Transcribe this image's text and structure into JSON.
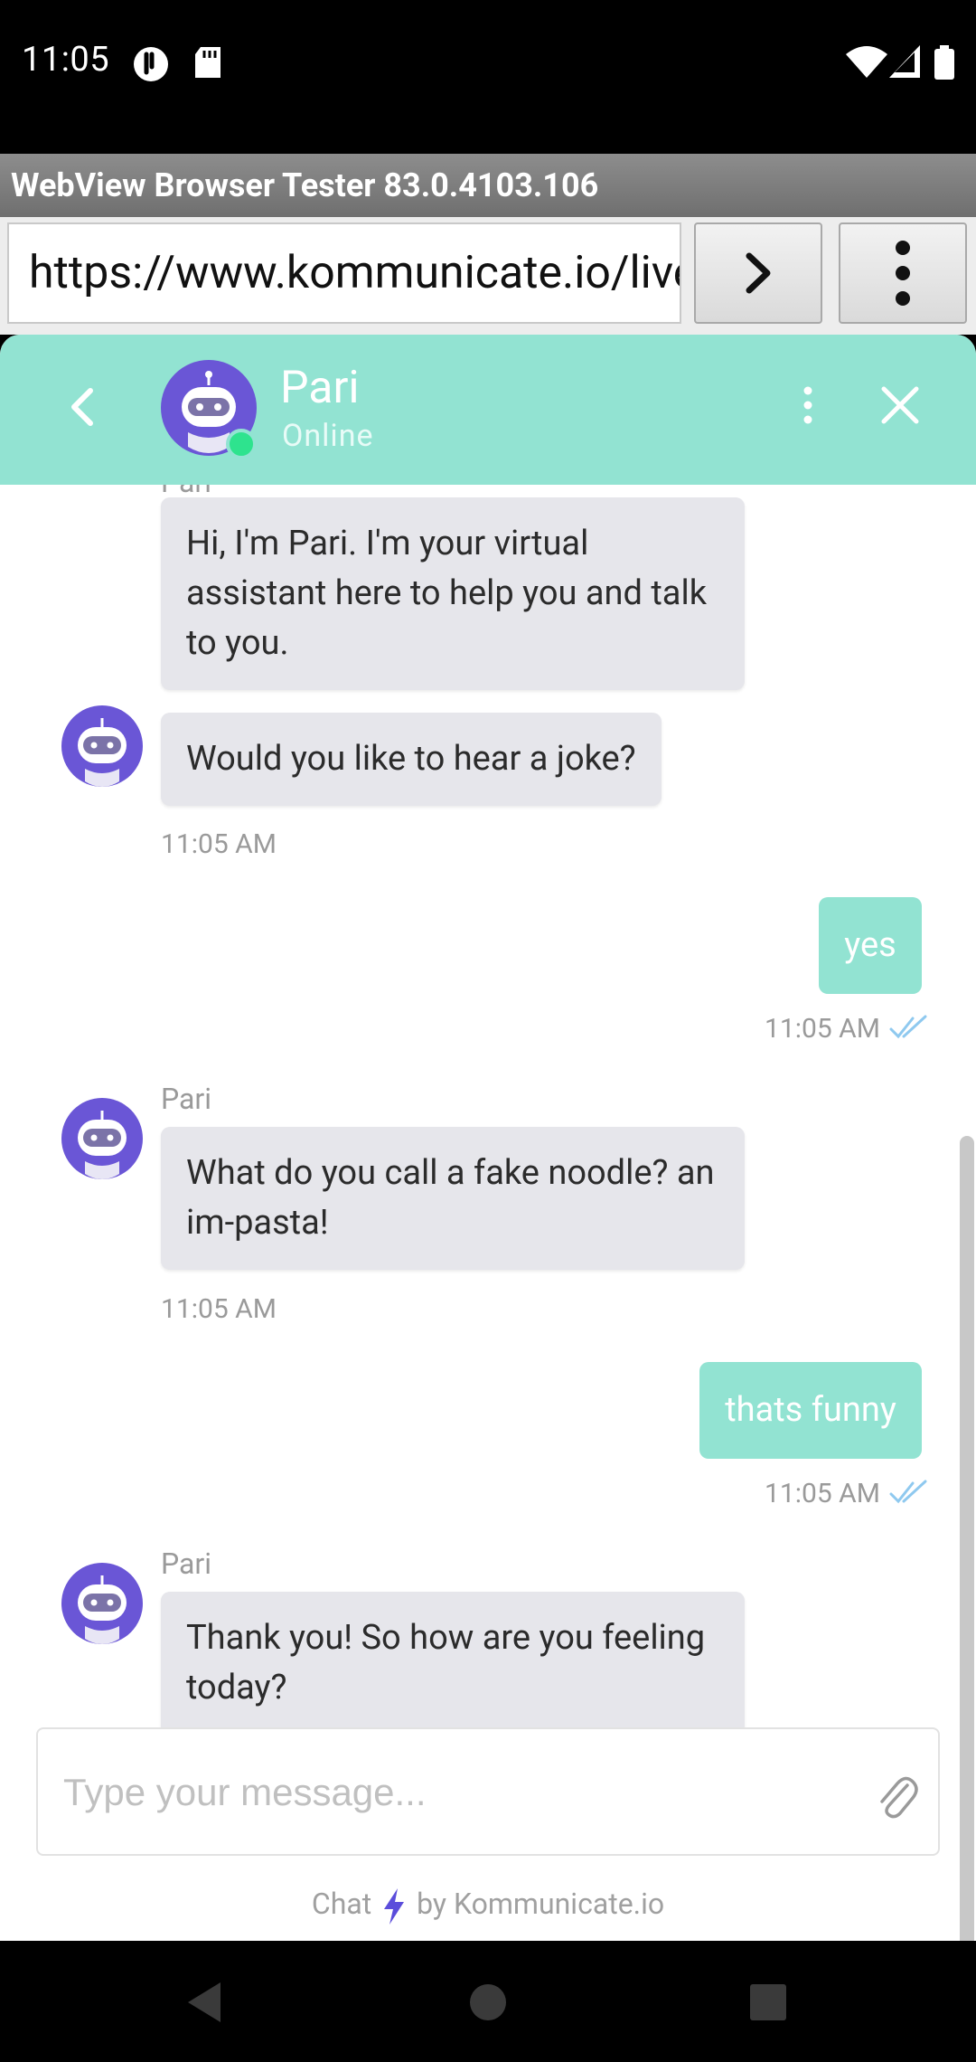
{
  "status_bar": {
    "time": "11:05",
    "icons": [
      "cursor-app-icon",
      "sd-card-icon",
      "wifi-icon",
      "signal-icon",
      "battery-icon"
    ]
  },
  "browser": {
    "title": "WebView Browser Tester 83.0.4103.106",
    "url": "https://www.kommunicate.io/livechat-demo",
    "go_icon": "chevron-right-icon",
    "menu_icon": "more-vertical-icon"
  },
  "chat": {
    "header": {
      "agent_name": "Pari",
      "agent_status": "Online",
      "colors": {
        "header_bg": "#92e3d2",
        "online_dot": "#2ee38e",
        "avatar_bg": "#6a56d6"
      }
    },
    "messages": [
      {
        "type": "incoming",
        "sender": "Pari",
        "text": "Hi, I'm Pari. I'm your virtual assistant here to help you and talk to you."
      },
      {
        "type": "incoming",
        "text": "Would you like to hear a joke?",
        "time": "11:05 AM"
      },
      {
        "type": "outgoing",
        "text": "yes",
        "time": "11:05 AM"
      },
      {
        "type": "incoming",
        "sender": "Pari",
        "text": "What do you call a fake noodle? an im-pasta!",
        "time": "11:05 AM"
      },
      {
        "type": "outgoing",
        "text": "thats funny",
        "time": "11:05 AM"
      },
      {
        "type": "incoming",
        "sender": "Pari",
        "text": "Thank you! So how are you feeling today?"
      }
    ],
    "composer": {
      "placeholder": "Type your message..."
    },
    "powered_by": {
      "prefix": "Chat",
      "suffix": "by Kommunicate.io"
    }
  },
  "nav": {
    "icons": [
      "back-triangle-icon",
      "home-circle-icon",
      "recents-square-icon"
    ]
  }
}
